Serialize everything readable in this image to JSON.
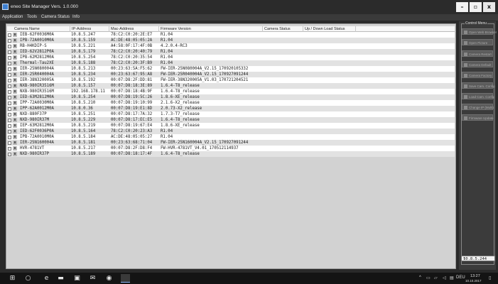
{
  "window": {
    "title": "eneo Site Manager  Vers. 1.0.000"
  },
  "menu": [
    "Application",
    "Tools",
    "Camera Status",
    "Info"
  ],
  "table": {
    "columns": {
      "name": "Camera Name",
      "ip": "IP-Address",
      "mac": "Mac-Address",
      "firmware": "Firmware Version",
      "status": "Camera Status",
      "transfer": "Up / Down Load Status"
    },
    "rows": [
      {
        "name": "IEB-62F0036M0A",
        "ip": "10.8.5.247",
        "mac": "78:C2:C0:20:2E:E7",
        "firmware": "R1.04"
      },
      {
        "name": "IPB-72A0010M0A",
        "ip": "10.8.5.159",
        "mac": "AC:DE:48:05:05:2A",
        "firmware": "R1.04"
      },
      {
        "name": "RB-H4KDIP-S",
        "ip": "10.8.5.221",
        "mac": "A4:58:0F:17:4F:0B",
        "firmware": "4.2.0.4-RC3"
      },
      {
        "name": "IED-62V2812P0A",
        "ip": "10.8.5.179",
        "mac": "78:C2:C0:20:40:79",
        "firmware": "R1.04"
      },
      {
        "name": "IPB-62M2812M0A",
        "ip": "10.8.5.254",
        "mac": "78:C2:C0:20:35:54",
        "firmware": "R1.04"
      },
      {
        "name": "Thermal-Tau2XE",
        "ip": "10.8.5.188",
        "mac": "78:C2:C0:20:3F:B9",
        "firmware": "R1.04"
      },
      {
        "name": "IER-25N080004A",
        "ip": "10.8.5.213",
        "mac": "00:23:63:5A:F5:62",
        "firmware": "FW-IER-25N080004A_V2.15_170920105332"
      },
      {
        "name": "IER-25R040004A",
        "ip": "10.8.5.234",
        "mac": "00:23:63:67:95:A8",
        "firmware": "FW-IER-25R040004A_V2.15_170927091244"
      },
      {
        "name": "IER-38N320005A",
        "ip": "10.8.5.192",
        "mac": "00:07:D8:2F:DD:81",
        "firmware": "FW-IER-38N320005A_V1.03_170721204521"
      },
      {
        "name": "NXB-980IR3516M",
        "ip": "10.8.5.157",
        "mac": "00:07:D8:18:3E:89",
        "firmware": "1.6.4-T8_release"
      },
      {
        "name": "NXB-980IR3516M",
        "ip": "192.168.178.11",
        "mac": "00:07:D8:18:4B:9F",
        "firmware": "1.6.4-T8_release"
      },
      {
        "name": "IED-63M2812M0A",
        "ip": "10.8.5.254",
        "mac": "00:07:D8:19:5C:26",
        "firmware": "1.8.6-XE_release"
      },
      {
        "name": "IPP-72A0030M0A",
        "ip": "10.8.5.210",
        "mac": "00:07:D8:19:10:99",
        "firmware": "2.1.6-X2_release"
      },
      {
        "name": "IPP-62A0012M0A",
        "ip": "10.8.0.36",
        "mac": "00:07:D8:19:E1:8D",
        "firmware": "2.0.73-X2_release"
      },
      {
        "name": "NXD-880F37P",
        "ip": "10.8.5.251",
        "mac": "00:07:D8:17:7A:32",
        "firmware": "1.7.3-T7_release"
      },
      {
        "name": "NXD-980IR37M",
        "ip": "10.8.5.229",
        "mac": "00:07:D8:17:EC:E5",
        "firmware": "1.6.4-T8_release"
      },
      {
        "name": "IEP-63M2812M0A",
        "ip": "10.8.5.219",
        "mac": "00:07:D8:19:67:E4",
        "firmware": "1.8.6-XE_release"
      },
      {
        "name": "IED-62F0036P0A",
        "ip": "10.8.5.164",
        "mac": "78:C2:C0:20:23:A3",
        "firmware": "R1.04"
      },
      {
        "name": "IPB-72A0010M0A",
        "ip": "10.8.5.184",
        "mac": "AC:DE:48:05:05:27",
        "firmware": "R1.04"
      },
      {
        "name": "IER-25N160004A",
        "ip": "10.8.5.181",
        "mac": "00:23:63:68:71:04",
        "firmware": "FW-IER-25N160004A_V2.15_170927091244"
      },
      {
        "name": "HVR-4781VT",
        "ip": "10.8.5.217",
        "mac": "00:07:D8:2F:D8:F4",
        "firmware": "FW-HVR-4781VT_V4.01_170512114937"
      },
      {
        "name": "NXD-980IR37P",
        "ip": "10.8.5.189",
        "mac": "00:07:D8:18:17:4F",
        "firmware": "1.6.4-T8_release"
      }
    ]
  },
  "control_menu": {
    "title": "Control Menu",
    "buttons": [
      "Open Web Browser",
      "Open Picture",
      "Camera Restart",
      "Camera Default",
      "Camera Factory",
      "Save Cam. Config",
      "Load Cam. Config",
      "Change IP (Multi)",
      "Firmware Update"
    ]
  },
  "ip_select": {
    "value": "10.8.5.244"
  },
  "taskbar": {
    "icons": [
      "windows-icon",
      "search-icon",
      "edge-icon",
      "explorer-icon",
      "store-icon",
      "mail-icon",
      "chrome-icon",
      "app-icon"
    ],
    "tray_lang": "DEU",
    "time": "13:27",
    "date": "10.10.2017"
  }
}
